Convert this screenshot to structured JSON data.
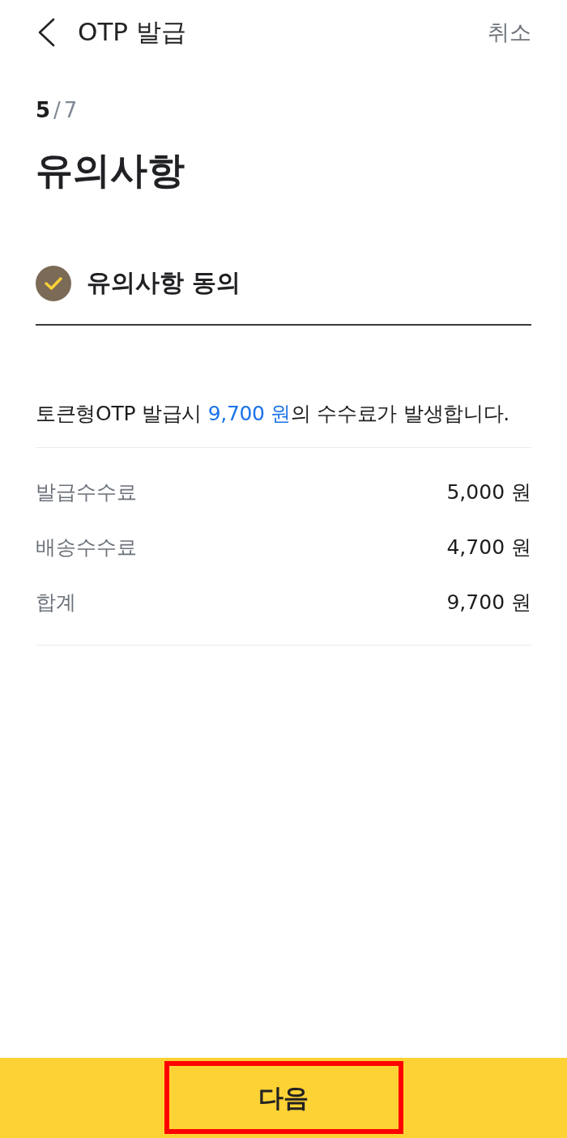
{
  "header": {
    "title": "OTP 발급",
    "cancel": "취소"
  },
  "step": {
    "current": "5",
    "separator": "/",
    "total": "7"
  },
  "title": "유의사항",
  "agreement": {
    "label": "유의사항 동의",
    "checked": true
  },
  "notice": {
    "before": "토큰형OTP 발급시 ",
    "amount": "9,700 원",
    "after": "의 수수료가 발생합니다."
  },
  "fees": [
    {
      "label": "발급수수료",
      "value": "5,000 원"
    },
    {
      "label": "배송수수료",
      "value": "4,700 원"
    },
    {
      "label": "합계",
      "value": "9,700 원"
    }
  ],
  "footer": {
    "button": "다음",
    "highlighted": true
  }
}
